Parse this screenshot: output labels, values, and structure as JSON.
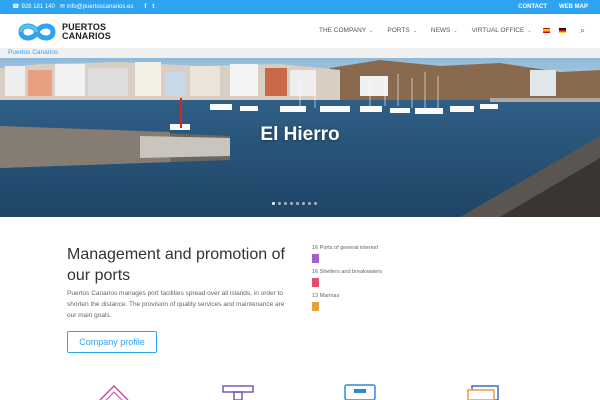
{
  "topbar": {
    "phone": "928 181 140",
    "email": "info@puertoscanarios.es",
    "social": [
      "f",
      "t"
    ],
    "links": [
      "CONTACT",
      "WEB MAP"
    ]
  },
  "logo": {
    "line1": "Puertos",
    "line2": "Canarios"
  },
  "nav": {
    "items": [
      {
        "label": "THE COMPANY"
      },
      {
        "label": "PORTS"
      },
      {
        "label": "NEWS"
      },
      {
        "label": "VIRTUAL OFFICE"
      }
    ],
    "languages": [
      "es-flag-icon",
      "de-flag-icon"
    ],
    "search_icon": "search-icon"
  },
  "breadcrumb": "Puertos Canarios",
  "slider": {
    "title": "El Hierro",
    "dot_count": 8,
    "active_dot": 0
  },
  "intro": {
    "title": "Management and promotion of our ports",
    "text": "Puertos Canarios manages port facilities spread over all islands, in order to shorten the distance. The provision of quality services and maintenance are our main goals.",
    "button": "Company profile"
  },
  "stats": [
    {
      "label": "16 Ports of general interest",
      "color": "#a064c8"
    },
    {
      "label": "16 Shelters and breakwaters",
      "color": "#e0506e"
    },
    {
      "label": "13 Marinas",
      "color": "#e8a040"
    }
  ],
  "colors": {
    "accent": "#2ea3f2"
  }
}
